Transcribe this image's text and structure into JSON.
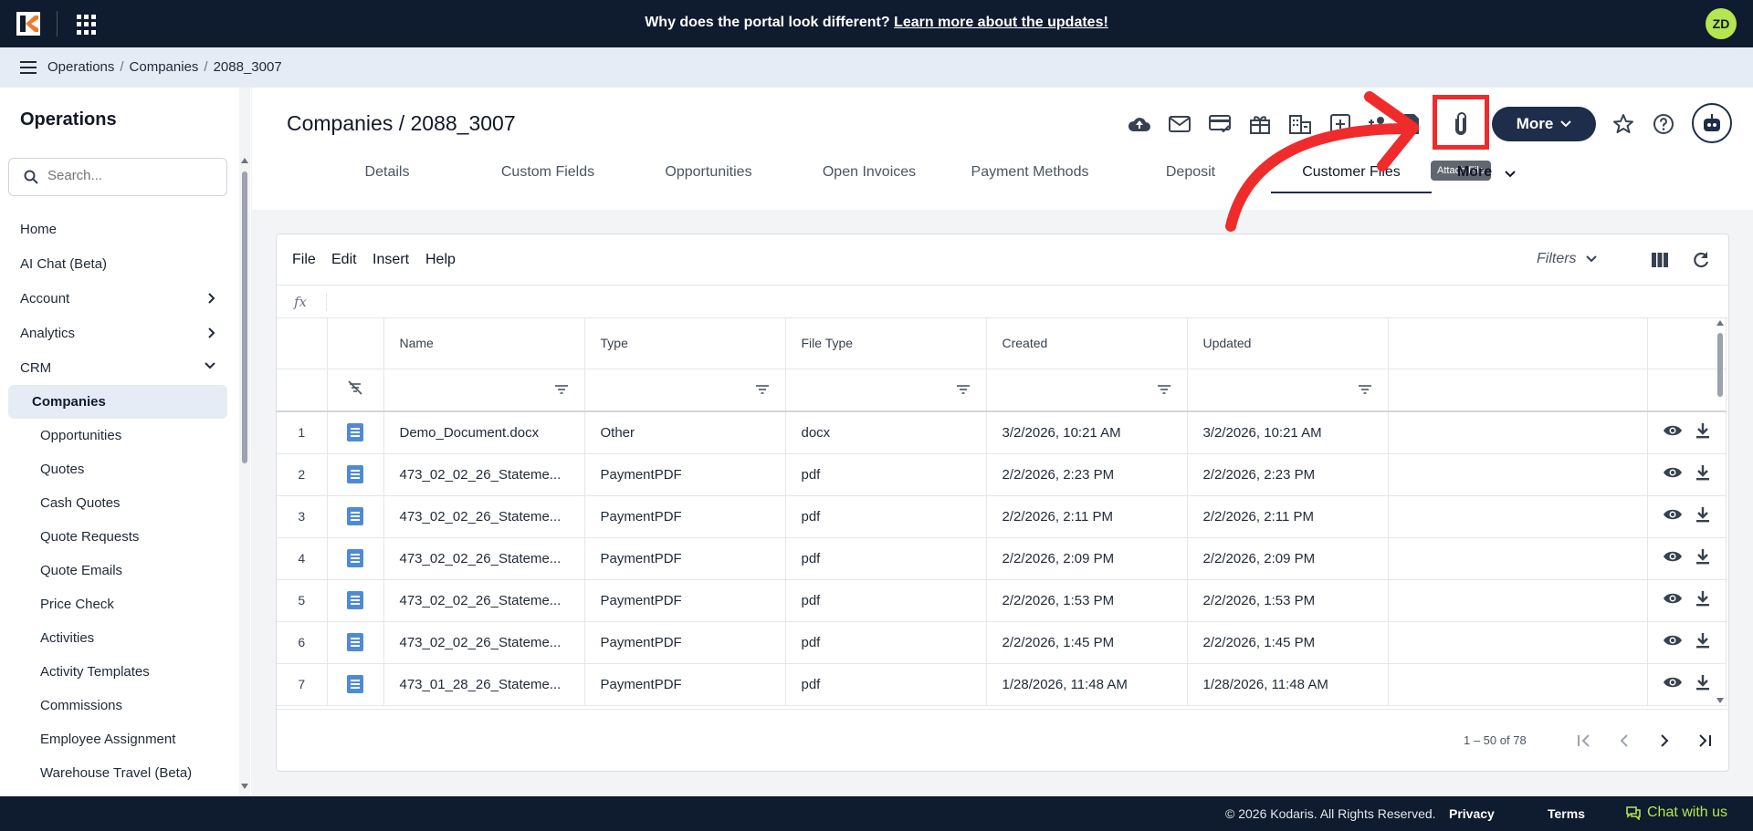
{
  "banner": {
    "text": "Why does the portal look different? ",
    "link": "Learn more about the updates!"
  },
  "user": {
    "initials": "ZD"
  },
  "breadcrumb": [
    "Operations",
    "Companies",
    "2088_3007"
  ],
  "sidebar": {
    "title": "Operations",
    "search_placeholder": "Search...",
    "items": [
      {
        "label": "Home",
        "chevron": ""
      },
      {
        "label": "AI Chat (Beta)",
        "chevron": ""
      },
      {
        "label": "Account",
        "chevron": "right"
      },
      {
        "label": "Analytics",
        "chevron": "right"
      },
      {
        "label": "CRM",
        "chevron": "down"
      }
    ],
    "sub_items": [
      "Companies",
      "Opportunities",
      "Quotes",
      "Cash Quotes",
      "Quote Requests",
      "Quote Emails",
      "Price Check",
      "Activities",
      "Activity Templates",
      "Commissions",
      "Employee Assignment",
      "Warehouse Travel (Beta)"
    ],
    "active_sub": "Companies"
  },
  "page": {
    "title": "Companies / 2088_3007",
    "more_label": "More",
    "tooltip": "Attach File",
    "tabs": [
      "Details",
      "Custom Fields",
      "Opportunities",
      "Open Invoices",
      "Payment Methods",
      "Deposit",
      "Customer Files"
    ],
    "active_tab": "Customer Files",
    "tabs_more": "More"
  },
  "grid": {
    "menu": [
      "File",
      "Edit",
      "Insert",
      "Help"
    ],
    "filters_label": "Filters",
    "fx_label": "fx",
    "columns": [
      "Name",
      "Type",
      "File Type",
      "Created",
      "Updated"
    ],
    "rows": [
      {
        "n": "1",
        "name": "Demo_Document.docx",
        "type": "Other",
        "file_type": "docx",
        "created": "3/2/2026, 10:21 AM",
        "updated": "3/2/2026, 10:21 AM"
      },
      {
        "n": "2",
        "name": "473_02_02_26_Stateme...",
        "type": "PaymentPDF",
        "file_type": "pdf",
        "created": "2/2/2026, 2:23 PM",
        "updated": "2/2/2026, 2:23 PM"
      },
      {
        "n": "3",
        "name": "473_02_02_26_Stateme...",
        "type": "PaymentPDF",
        "file_type": "pdf",
        "created": "2/2/2026, 2:11 PM",
        "updated": "2/2/2026, 2:11 PM"
      },
      {
        "n": "4",
        "name": "473_02_02_26_Stateme...",
        "type": "PaymentPDF",
        "file_type": "pdf",
        "created": "2/2/2026, 2:09 PM",
        "updated": "2/2/2026, 2:09 PM"
      },
      {
        "n": "5",
        "name": "473_02_02_26_Stateme...",
        "type": "PaymentPDF",
        "file_type": "pdf",
        "created": "2/2/2026, 1:53 PM",
        "updated": "2/2/2026, 1:53 PM"
      },
      {
        "n": "6",
        "name": "473_02_02_26_Stateme...",
        "type": "PaymentPDF",
        "file_type": "pdf",
        "created": "2/2/2026, 1:45 PM",
        "updated": "2/2/2026, 1:45 PM"
      },
      {
        "n": "7",
        "name": "473_01_28_26_Stateme...",
        "type": "PaymentPDF",
        "file_type": "pdf",
        "created": "1/28/2026, 11:48 AM",
        "updated": "1/28/2026, 11:48 AM"
      }
    ],
    "pager_text": "1 – 50 of 78"
  },
  "footer": {
    "copyright": "© 2026 Kodaris. All Rights Reserved.",
    "privacy": "Privacy",
    "terms": "Terms",
    "chat": "Chat with us"
  },
  "colors": {
    "navy": "#0f1b2e",
    "accent_green": "#b5e550",
    "highlight_red": "#ef2b2b",
    "doc_blue": "#4f8ad9"
  }
}
